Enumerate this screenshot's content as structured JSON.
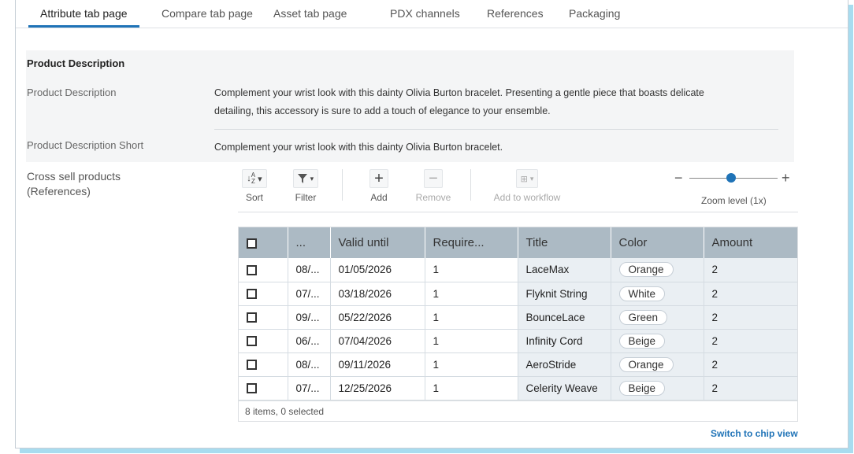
{
  "tabs": [
    "Attribute tab page",
    "Compare tab page",
    "Asset tab page",
    "PDX channels",
    "References",
    "Packaging"
  ],
  "section_title": "Product Description",
  "fields": {
    "desc_label": "Product Description",
    "desc_line1": "Complement your wrist look with this dainty Olivia Burton bracelet. Presenting a gentle piece that boasts delicate",
    "desc_line2": "detailing, this accessory is sure to add a touch of elegance to your ensemble.",
    "short_label": "Product Description Short",
    "short_value": "Complement your wrist look with this dainty Olivia Burton bracelet.",
    "cross_label_1": "Cross sell products",
    "cross_label_2": "(References)"
  },
  "toolbar": {
    "sort": "Sort",
    "filter": "Filter",
    "add": "Add",
    "remove": "Remove",
    "workflow": "Add to workflow",
    "zoom": "Zoom level (1x)",
    "zoom_minus": "−",
    "zoom_plus": "+"
  },
  "table": {
    "headers": [
      "",
      "...",
      "Valid until",
      "Require...",
      "Title",
      "Color",
      "Amount"
    ],
    "rows": [
      {
        "c1": "08/...",
        "valid": "01/05/2026",
        "req": "1",
        "title": "LaceMax",
        "color": "Orange",
        "amount": "2"
      },
      {
        "c1": "07/...",
        "valid": "03/18/2026",
        "req": "1",
        "title": "Flyknit String",
        "color": "White",
        "amount": "2"
      },
      {
        "c1": "09/...",
        "valid": "05/22/2026",
        "req": "1",
        "title": "BounceLace",
        "color": "Green",
        "amount": "2"
      },
      {
        "c1": "06/...",
        "valid": "07/04/2026",
        "req": "1",
        "title": "Infinity Cord",
        "color": "Beige",
        "amount": "2"
      },
      {
        "c1": "08/...",
        "valid": "09/11/2026",
        "req": "1",
        "title": "AeroStride",
        "color": "Orange",
        "amount": "2"
      },
      {
        "c1": "07/...",
        "valid": "12/25/2026",
        "req": "1",
        "title": "Celerity Weave",
        "color": "Beige",
        "amount": "2"
      }
    ],
    "footer": "8 items, 0 selected"
  },
  "switch_link": "Switch to chip view",
  "colors": {
    "accent": "#1f73b7",
    "header_bg": "#acbac4",
    "row_bg": "#eaeff3"
  }
}
